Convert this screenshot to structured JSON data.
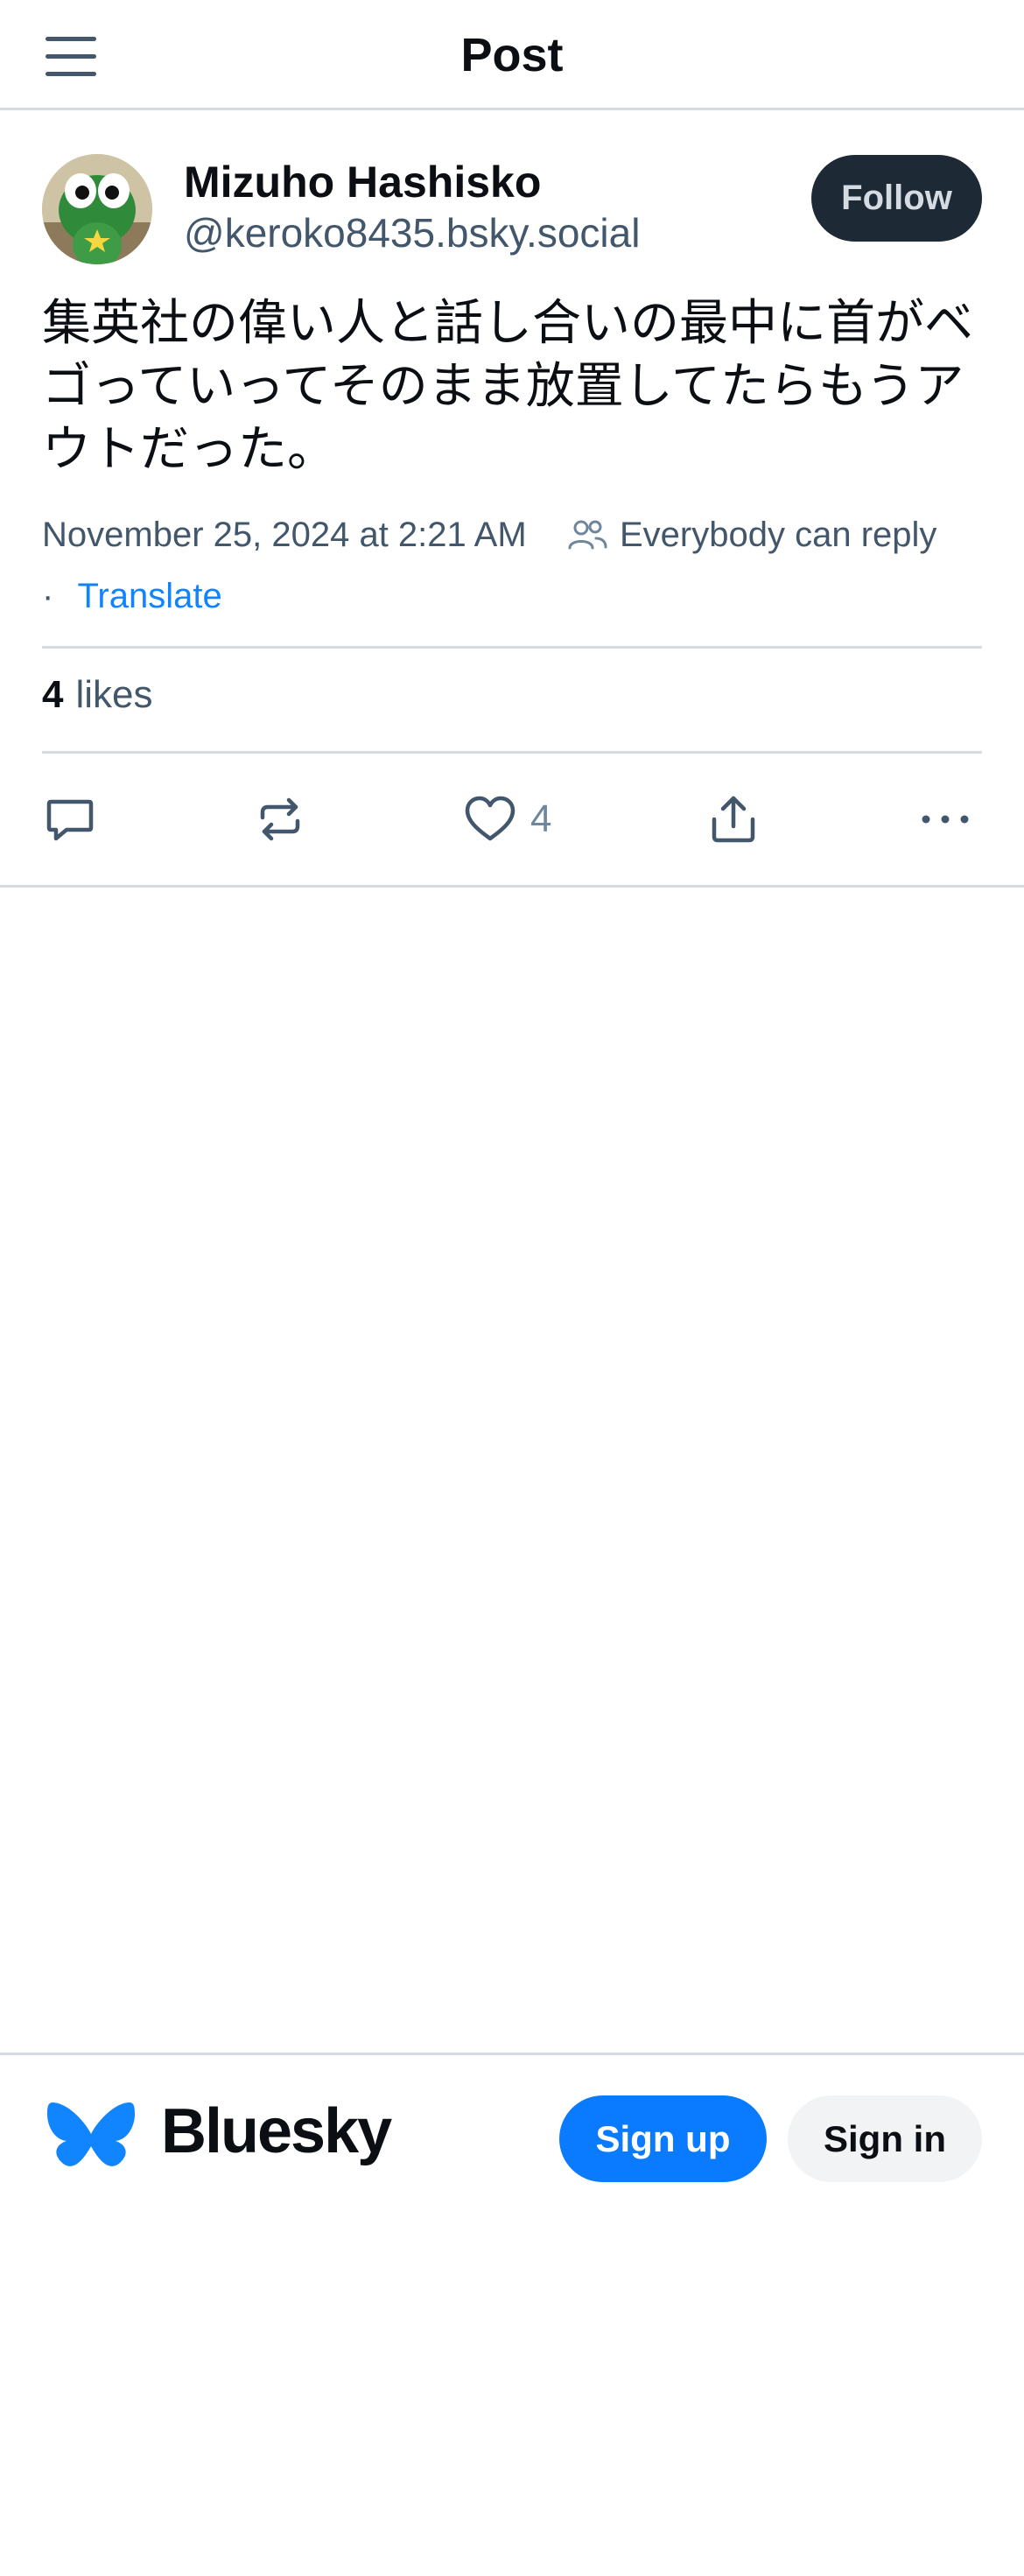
{
  "header": {
    "title": "Post",
    "menu_icon": "hamburger-menu-icon"
  },
  "post": {
    "author": {
      "display_name": "Mizuho Hashisko",
      "handle": "@keroko8435.bsky.social"
    },
    "follow_label": "Follow",
    "text": "集英社の偉い人と話し合いの最中に首がベゴっていってそのまま放置してたらもうアウトだった。",
    "timestamp": "November 25, 2024 at 2:21 AM",
    "reply_setting": "Everybody can reply",
    "separator": "·",
    "translate_label": "Translate",
    "likes": {
      "count": "4",
      "label": "likes"
    },
    "actions": {
      "reply_icon": "reply-icon",
      "repost_icon": "repost-icon",
      "like_icon": "heart-icon",
      "like_count": "4",
      "share_icon": "share-icon",
      "more_icon": "more-options-icon"
    }
  },
  "footer": {
    "brand": "Bluesky",
    "signup_label": "Sign up",
    "signin_label": "Sign in"
  },
  "colors": {
    "text_primary": "#0b0f14",
    "text_secondary": "#42576c",
    "link": "#1083fe",
    "accent": "#0a7aff",
    "follow_bg": "#1e2936",
    "border": "#d4dbe2"
  }
}
